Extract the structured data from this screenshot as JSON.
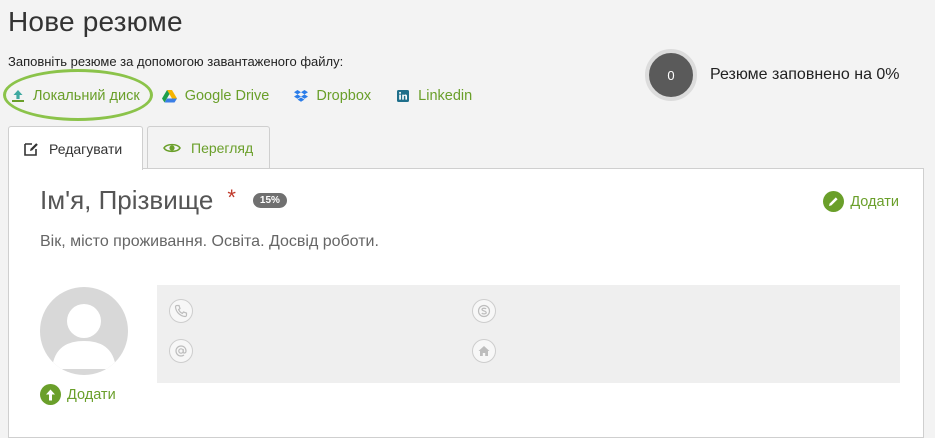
{
  "page": {
    "title": "Нове резюме",
    "upload_hint": "Заповніть резюме за допомогою завантаженого файлу:"
  },
  "sources": [
    {
      "label": "Локальний диск",
      "icon": "upload-icon"
    },
    {
      "label": "Google Drive",
      "icon": "google-drive-icon"
    },
    {
      "label": "Dropbox",
      "icon": "dropbox-icon"
    },
    {
      "label": "Linkedin",
      "icon": "linkedin-icon"
    }
  ],
  "progress": {
    "value": "0",
    "text": "Резюме заповнено на 0%"
  },
  "tabs": [
    {
      "label": "Редагувати",
      "icon": "edit-icon",
      "active": true
    },
    {
      "label": "Перегляд",
      "icon": "eye-icon",
      "active": false
    }
  ],
  "card": {
    "name_title": "Ім'я, Прізвище",
    "required_mark": "*",
    "percent_badge": "15%",
    "add_label": "Додати",
    "subtitle": "Вік, місто проживання. Освіта. Досвід роботи.",
    "photo_add_label": "Додати"
  },
  "contacts": [
    {
      "icon": "phone-icon"
    },
    {
      "icon": "skype-icon"
    },
    {
      "icon": "email-icon"
    },
    {
      "icon": "home-icon"
    }
  ],
  "colors": {
    "accent": "#6a9f2a",
    "highlight": "#8bc34a",
    "background": "#f3f3f3",
    "required": "#c0392b",
    "progress_circle": "#5a5a5a"
  }
}
